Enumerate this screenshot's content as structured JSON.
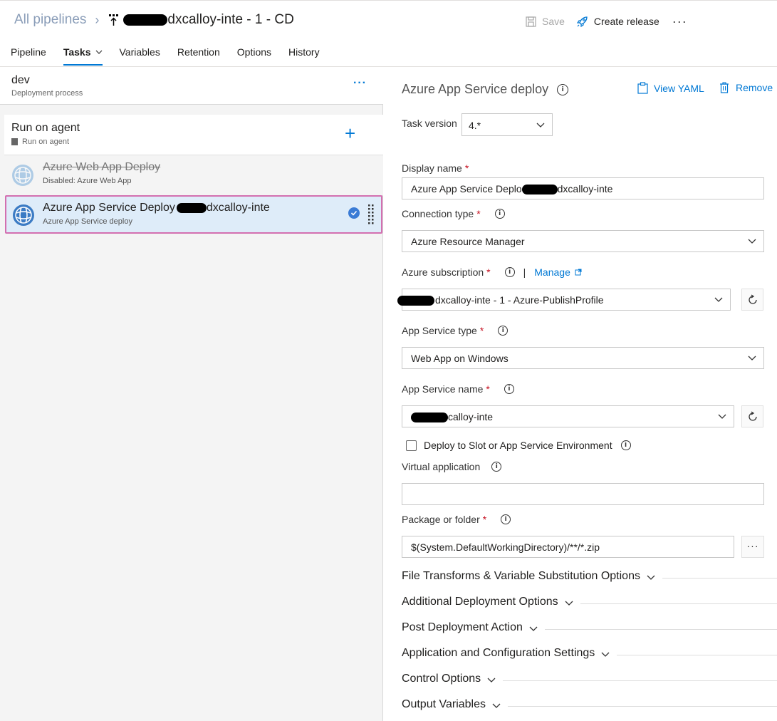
{
  "header": {
    "breadcrumb_all": "All pipelines",
    "pipeline_title": "dxcalloy-inte - 1 - CD",
    "save_label": "Save",
    "create_release_label": "Create release",
    "more_label": "···"
  },
  "tabs": [
    {
      "label": "Pipeline"
    },
    {
      "label": "Tasks"
    },
    {
      "label": "Variables"
    },
    {
      "label": "Retention"
    },
    {
      "label": "Options"
    },
    {
      "label": "History"
    }
  ],
  "stage": {
    "name": "dev",
    "subtitle": "Deployment process",
    "more": "···"
  },
  "agent_job": {
    "name": "Run on agent",
    "subtitle": "Run on agent",
    "add": "+"
  },
  "tasks": [
    {
      "name": "Azure Web App Deploy",
      "subtitle": "Disabled: Azure Web App",
      "disabled": true
    },
    {
      "name_prefix": "Azure App Service Deploy",
      "name_suffix": "dxcalloy-inte",
      "subtitle": "Azure App Service deploy",
      "selected": true
    }
  ],
  "details": {
    "title": "Azure App Service deploy",
    "view_yaml": "View YAML",
    "remove": "Remove",
    "task_version_label": "Task version",
    "task_version_value": "4.*",
    "display_name_label": "Display name",
    "display_name_prefix": "Azure App Service Deplo",
    "display_name_suffix": "dxcalloy-inte",
    "connection_type_label": "Connection type",
    "connection_type_value": "Azure Resource Manager",
    "subscription_label": "Azure subscription",
    "manage_label": "Manage",
    "subscription_value": "dxcalloy-inte - 1 - Azure-PublishProfile",
    "app_service_type_label": "App Service type",
    "app_service_type_value": "Web App on Windows",
    "app_service_name_label": "App Service name",
    "app_service_name_value": "calloy-inte",
    "slot_checkbox_label": "Deploy to Slot or App Service Environment",
    "slot_checked": false,
    "virtual_app_label": "Virtual application",
    "virtual_app_value": "",
    "package_label": "Package or folder",
    "package_value": "$(System.DefaultWorkingDirectory)/**/*.zip",
    "package_more": "···"
  },
  "sections": [
    {
      "label": "File Transforms & Variable Substitution Options"
    },
    {
      "label": "Additional Deployment Options"
    },
    {
      "label": "Post Deployment Action"
    },
    {
      "label": "Application and Configuration Settings"
    },
    {
      "label": "Control Options"
    },
    {
      "label": "Output Variables"
    }
  ],
  "colors": {
    "accent": "#0078d4",
    "selected_bg": "#deecf9",
    "selected_border": "#d36fb0",
    "required": "#c50f1f"
  }
}
